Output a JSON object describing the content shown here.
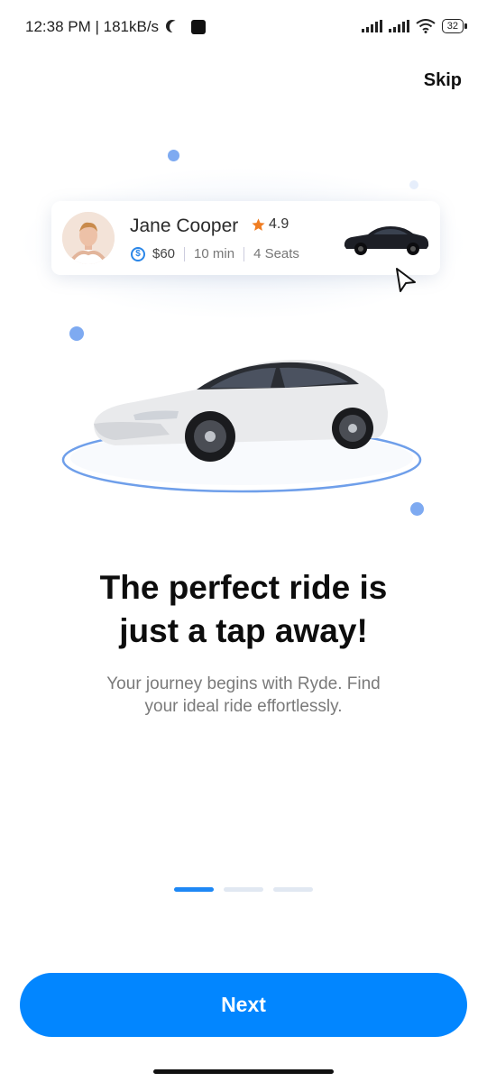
{
  "status_bar": {
    "time": "12:38 PM | 181kB/s",
    "battery": "32"
  },
  "skip_label": "Skip",
  "driver_card": {
    "name": "Jane Cooper",
    "rating": "4.9",
    "price": "$60",
    "duration": "10 min",
    "seats": "4 Seats"
  },
  "headline": {
    "line1": "The perfect ride is",
    "line2": "just a tap away!"
  },
  "subtext": {
    "line1": "Your journey begins with Ryde. Find",
    "line2": "your ideal ride effortlessly."
  },
  "pager": {
    "count": 3,
    "active_index": 0
  },
  "next_label": "Next",
  "colors": {
    "primary": "#0286ff",
    "dot": "#7eaaf1",
    "star": "#f07d22"
  },
  "icons": [
    "moon-icon",
    "notification-icon",
    "signal-icon",
    "wifi-icon",
    "battery-icon",
    "star-icon",
    "dollar-icon",
    "cursor-icon"
  ]
}
